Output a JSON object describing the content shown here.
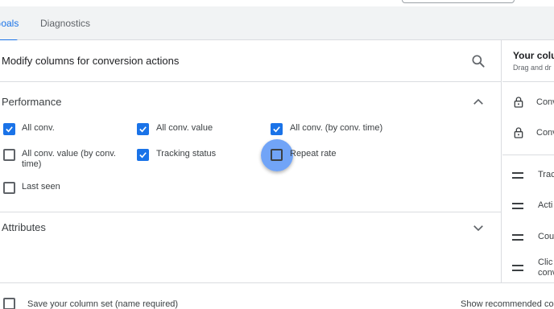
{
  "tabs": [
    {
      "label": "Goals"
    },
    {
      "label": "Diagnostics"
    }
  ],
  "panel": {
    "title": "Modify columns for conversion actions"
  },
  "performance": {
    "title": "Performance",
    "items": [
      {
        "label": "All conv.",
        "checked": true
      },
      {
        "label": "All conv. value",
        "checked": true
      },
      {
        "label": "All conv. (by conv. time)",
        "checked": true
      },
      {
        "label": "All conv. value (by conv. time)",
        "checked": false
      },
      {
        "label": "Tracking status",
        "checked": true
      },
      {
        "label": "Repeat rate",
        "checked": false
      },
      {
        "label": "Last seen",
        "checked": false
      }
    ]
  },
  "attributes": {
    "title": "Attributes"
  },
  "footer": {
    "save_label": "Save your column set (name required)",
    "show_label": "Show recommended colu"
  },
  "right_panel": {
    "title": "Your colu",
    "subtitle": "Drag and dr",
    "locked": [
      {
        "label": "Conv"
      },
      {
        "label": "Conv"
      }
    ],
    "draggable": [
      {
        "label": "Trac"
      },
      {
        "label": "Acti"
      },
      {
        "label": "Cou"
      },
      {
        "label": "Clic",
        "label2": "conv"
      }
    ]
  },
  "colors": {
    "accent": "#1a73e8",
    "border": "#dadce0",
    "text": "#3c4043"
  }
}
